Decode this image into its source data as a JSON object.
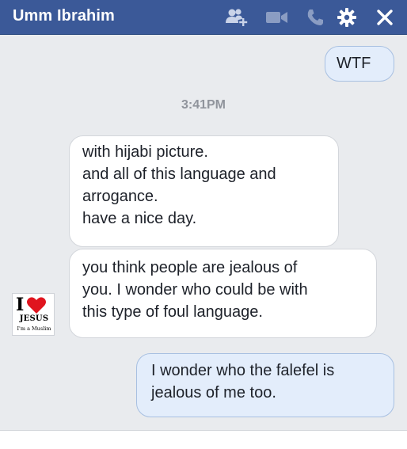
{
  "header": {
    "title": "Umm Ibrahim",
    "icons": [
      "add-friend-icon",
      "video-call-icon",
      "voice-call-icon",
      "settings-gear-icon",
      "close-icon"
    ]
  },
  "colors": {
    "header_bg": "#3b5998",
    "incoming_bubble": "#ffffff",
    "outgoing_bubble": "#e3edfb",
    "timestamp": "#90949c"
  },
  "messages": [
    {
      "direction": "outgoing",
      "lines": [
        "WTF"
      ]
    },
    {
      "direction": "incoming",
      "lines": [
        "with hijabi picture.",
        "and all of this language and",
        "arrogance.",
        "have a nice day."
      ]
    },
    {
      "direction": "incoming",
      "lines": [
        "you think people are jealous of",
        "you. I wonder who could be with",
        "this type of foul language."
      ]
    },
    {
      "direction": "outgoing",
      "lines": [
        "I wonder who the falefel is",
        "jealous of me too."
      ]
    }
  ],
  "timestamp": "3:41PM",
  "avatar": {
    "letter": "I",
    "word": "JESUS",
    "small_text": "I'm a Muslim"
  }
}
